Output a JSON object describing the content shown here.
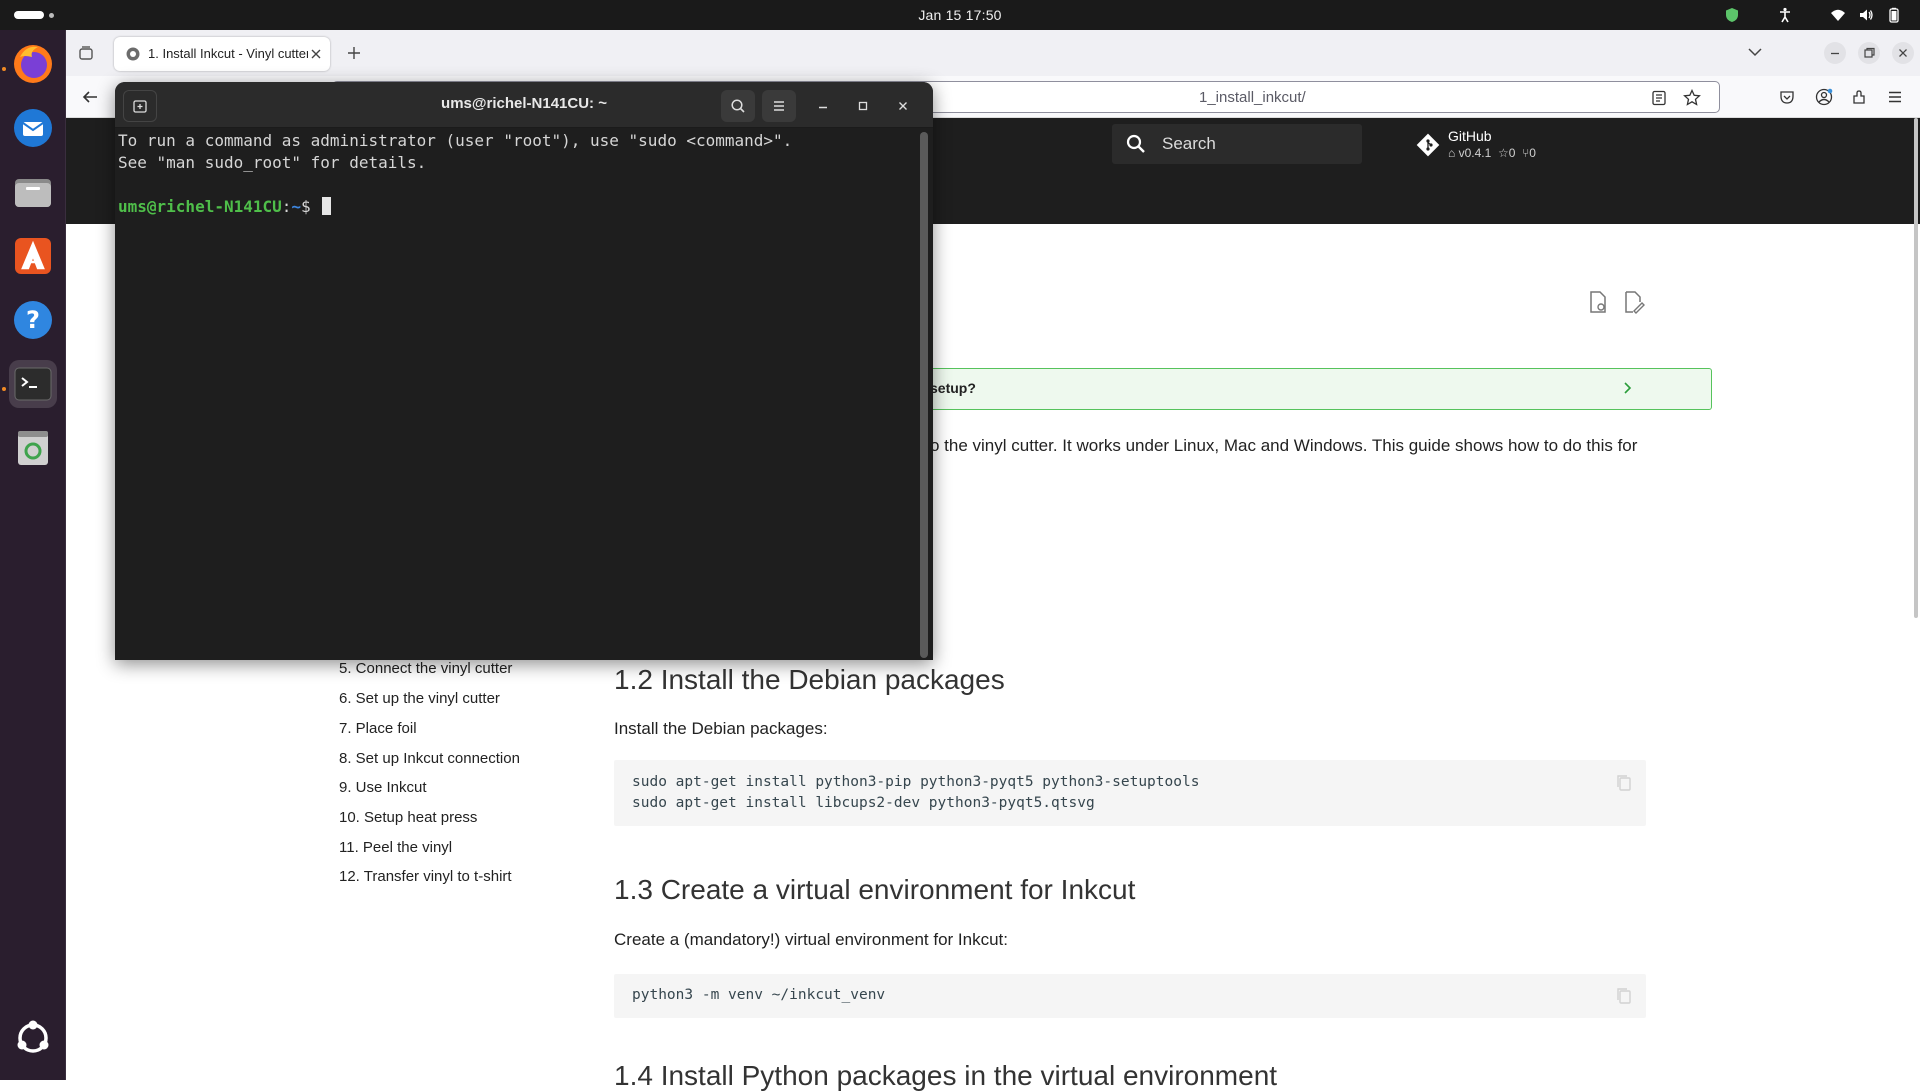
{
  "topbar": {
    "datetime": "Jan 15  17:50"
  },
  "dock": {
    "apps": [
      "firefox-icon",
      "thunderbird-icon",
      "files-icon",
      "app-center-icon",
      "help-icon",
      "terminal-icon",
      "trash-icon",
      "show-apps-icon"
    ]
  },
  "browser": {
    "tab_title": "1. Install Inkcut - Vinyl cutter",
    "url_fragment": "1_install_inkcut/"
  },
  "site": {
    "search_placeholder": "Search",
    "repo_title": "GitHub",
    "repo_version": "v0.4.1",
    "repo_stars": "0",
    "repo_forks": "0"
  },
  "admonition": {
    "title_fragment": "setup?"
  },
  "intro_fragment": "o the vinyl cutter. It works under Linux, Mac and Windows. This guide shows how to do this for",
  "nav": {
    "items": [
      "5. Connect the vinyl cutter",
      "6. Set up the vinyl cutter",
      "7. Place foil",
      "8. Set up Inkcut connection",
      "9. Use Inkcut",
      "10. Setup heat press",
      "11. Peel the vinyl",
      "12. Transfer vinyl to t-shirt"
    ]
  },
  "sections": {
    "s12_title": "1.2 Install the Debian packages",
    "s12_text": "Install the Debian packages:",
    "s12_code": [
      "sudo apt-get install python3-pip python3-pyqt5 python3-setuptools",
      "sudo apt-get install libcups2-dev python3-pyqt5.qtsvg"
    ],
    "s13_title": "1.3 Create a virtual environment for Inkcut",
    "s13_text": "Create a (mandatory!) virtual environment for Inkcut:",
    "s13_code": "python3 -m venv ~/inkcut_venv",
    "s14_title": "1.4 Install Python packages in the virtual environment"
  },
  "terminal": {
    "title": "ums@richel-N141CU: ~",
    "line1": "To run a command as administrator (user \"root\"), use \"sudo <command>\".",
    "line2": "See \"man sudo_root\" for details.",
    "prompt_user": "ums@richel-N141CU",
    "prompt_sep": ":",
    "prompt_path": "~",
    "prompt_sym": "$ "
  }
}
